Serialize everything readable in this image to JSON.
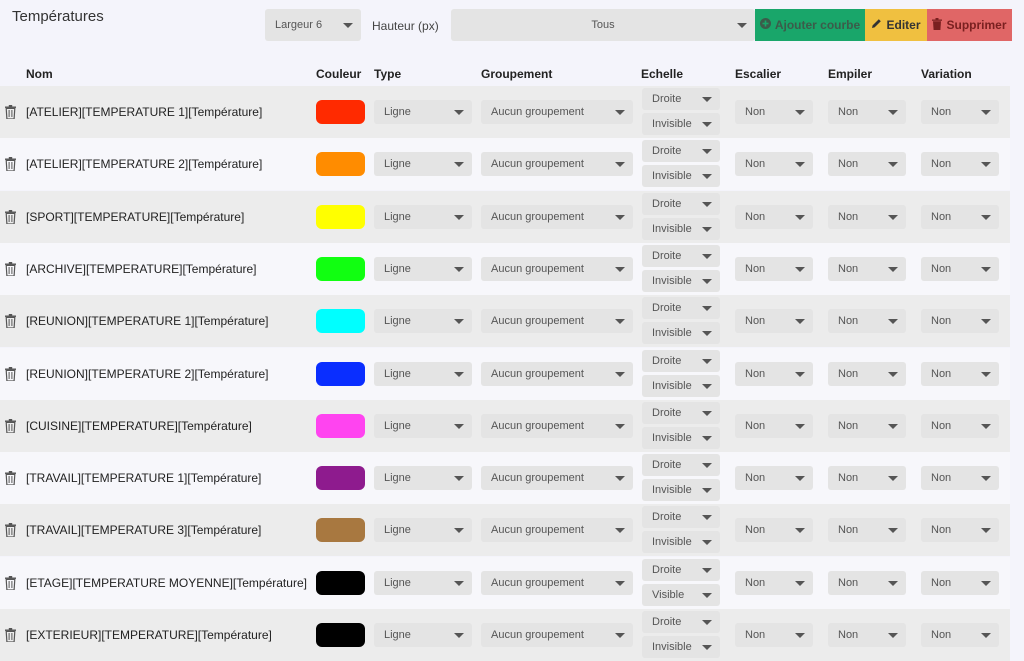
{
  "title": "Températures",
  "toolbar": {
    "largeur": "Largeur 6",
    "hauteur_label": "Hauteur (px)",
    "filter": "Tous",
    "add_label": "Ajouter courbe",
    "edit_label": "Editer",
    "delete_label": "Supprimer"
  },
  "columns": {
    "nom": "Nom",
    "couleur": "Couleur",
    "type": "Type",
    "groupement": "Groupement",
    "echelle": "Echelle",
    "escalier": "Escalier",
    "empiler": "Empiler",
    "variation": "Variation"
  },
  "icons": {
    "trash": "trash-icon",
    "add": "plus-circle-icon",
    "edit": "pencil-icon",
    "delete": "trash-icon",
    "caret": "caret-down-icon"
  },
  "rows": [
    {
      "name": "[ATELIER][TEMPERATURE 1][Température]",
      "color": "#ff2a00",
      "type": "Ligne",
      "groupement": "Aucun groupement",
      "echelle_side": "Droite",
      "echelle_vis": "Invisible",
      "escalier": "Non",
      "empiler": "Non",
      "variation": "Non"
    },
    {
      "name": "[ATELIER][TEMPERATURE 2][Température]",
      "color": "#ff8c00",
      "type": "Ligne",
      "groupement": "Aucun groupement",
      "echelle_side": "Droite",
      "echelle_vis": "Invisible",
      "escalier": "Non",
      "empiler": "Non",
      "variation": "Non"
    },
    {
      "name": "[SPORT][TEMPERATURE][Température]",
      "color": "#ffff00",
      "type": "Ligne",
      "groupement": "Aucun groupement",
      "echelle_side": "Droite",
      "echelle_vis": "Invisible",
      "escalier": "Non",
      "empiler": "Non",
      "variation": "Non"
    },
    {
      "name": "[ARCHIVE][TEMPERATURE][Température]",
      "color": "#11ff11",
      "type": "Ligne",
      "groupement": "Aucun groupement",
      "echelle_side": "Droite",
      "echelle_vis": "Invisible",
      "escalier": "Non",
      "empiler": "Non",
      "variation": "Non"
    },
    {
      "name": "[REUNION][TEMPERATURE 1][Température]",
      "color": "#00ffff",
      "type": "Ligne",
      "groupement": "Aucun groupement",
      "echelle_side": "Droite",
      "echelle_vis": "Invisible",
      "escalier": "Non",
      "empiler": "Non",
      "variation": "Non"
    },
    {
      "name": "[REUNION][TEMPERATURE 2][Température]",
      "color": "#0a2eff",
      "type": "Ligne",
      "groupement": "Aucun groupement",
      "echelle_side": "Droite",
      "echelle_vis": "Invisible",
      "escalier": "Non",
      "empiler": "Non",
      "variation": "Non"
    },
    {
      "name": "[CUISINE][TEMPERATURE][Température]",
      "color": "#ff44f0",
      "type": "Ligne",
      "groupement": "Aucun groupement",
      "echelle_side": "Droite",
      "echelle_vis": "Invisible",
      "escalier": "Non",
      "empiler": "Non",
      "variation": "Non"
    },
    {
      "name": "[TRAVAIL][TEMPERATURE 1][Température]",
      "color": "#8e1b8e",
      "type": "Ligne",
      "groupement": "Aucun groupement",
      "echelle_side": "Droite",
      "echelle_vis": "Invisible",
      "escalier": "Non",
      "empiler": "Non",
      "variation": "Non"
    },
    {
      "name": "[TRAVAIL][TEMPERATURE 3][Température]",
      "color": "#a87840",
      "type": "Ligne",
      "groupement": "Aucun groupement",
      "echelle_side": "Droite",
      "echelle_vis": "Invisible",
      "escalier": "Non",
      "empiler": "Non",
      "variation": "Non"
    },
    {
      "name": "[ETAGE][TEMPERATURE MOYENNE][Température]",
      "color": "#000000",
      "type": "Ligne",
      "groupement": "Aucun groupement",
      "echelle_side": "Droite",
      "echelle_vis": "Visible",
      "escalier": "Non",
      "empiler": "Non",
      "variation": "Non"
    },
    {
      "name": "[EXTERIEUR][TEMPERATURE][Température]",
      "color": "#000000",
      "type": "Ligne",
      "groupement": "Aucun groupement",
      "echelle_side": "Droite",
      "echelle_vis": "Invisible",
      "escalier": "Non",
      "empiler": "Non",
      "variation": "Non"
    }
  ]
}
